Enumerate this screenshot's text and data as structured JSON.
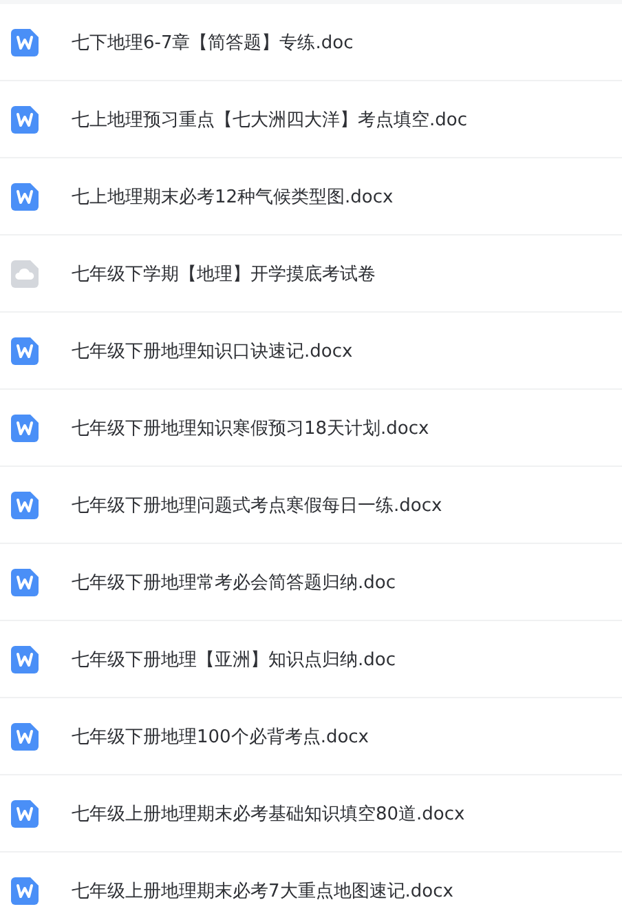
{
  "files": [
    {
      "kind": "word",
      "name": "七下地理6-7章【简答题】专练.doc"
    },
    {
      "kind": "word",
      "name": "七上地理预习重点【七大洲四大洋】考点填空.doc"
    },
    {
      "kind": "word",
      "name": "七上地理期末必考12种气候类型图.docx"
    },
    {
      "kind": "cloud",
      "name": "七年级下学期【地理】开学摸底考试卷"
    },
    {
      "kind": "word",
      "name": "七年级下册地理知识口诀速记.docx"
    },
    {
      "kind": "word",
      "name": "七年级下册地理知识寒假预习18天计划.docx"
    },
    {
      "kind": "word",
      "name": "七年级下册地理问题式考点寒假每日一练.docx"
    },
    {
      "kind": "word",
      "name": "七年级下册地理常考必会简答题归纳.doc"
    },
    {
      "kind": "word",
      "name": "七年级下册地理【亚洲】知识点归纳.doc"
    },
    {
      "kind": "word",
      "name": "七年级下册地理100个必背考点.docx"
    },
    {
      "kind": "word",
      "name": "七年级上册地理期末必考基础知识填空80道.docx"
    },
    {
      "kind": "word",
      "name": "七年级上册地理期末必考7大重点地图速记.docx"
    }
  ]
}
